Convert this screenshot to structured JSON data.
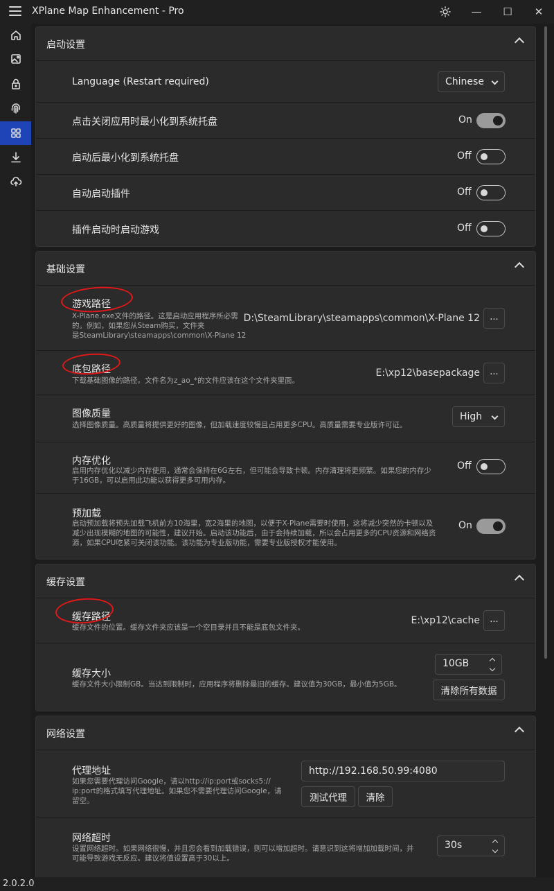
{
  "app": {
    "title": "XPlane Map Enhancement - Pro",
    "version": "2.0.2.0"
  },
  "titlebar": {
    "theme_icon": "sun-icon",
    "minimize_glyph": "—",
    "maximize_glyph": "☐",
    "close_glyph": "✕"
  },
  "sidebar": {
    "items": [
      {
        "icon": "home-icon"
      },
      {
        "icon": "image-icon"
      },
      {
        "icon": "lock-icon"
      },
      {
        "icon": "fingerprint-icon"
      },
      {
        "icon": "grid-icon",
        "active": true
      },
      {
        "icon": "download-icon"
      },
      {
        "icon": "cloud-upload-icon"
      }
    ]
  },
  "colors": {
    "accent": "#1e44b8",
    "annotation": "#e01818"
  },
  "startup": {
    "title": "启动设置",
    "language": {
      "label": "Language (Restart required)",
      "value": "Chinese"
    },
    "minimize_to_tray_on_close": {
      "label": "点击关闭应用时最小化到系统托盘",
      "state": "On"
    },
    "minimize_after_start": {
      "label": "启动后最小化到系统托盘",
      "state": "Off"
    },
    "auto_start_plugin": {
      "label": "自动启动插件",
      "state": "Off"
    },
    "start_game_with_plugin": {
      "label": "插件启动时启动游戏",
      "state": "Off"
    }
  },
  "basic": {
    "title": "基础设置",
    "game_path": {
      "label": "游戏路径",
      "desc": [
        "X-Plane.exe文件的路径。这是启动应用程序所必需",
        "的。例如，如果您从Steam购买，文件夹",
        "是SteamLibrary\\steamapps\\common\\X-Plane 12"
      ],
      "value": "D:\\SteamLibrary\\steamapps\\common\\X-Plane 12",
      "button": "..."
    },
    "base_package_path": {
      "label": "底包路径",
      "desc": "下载基础图像的路径。文件名为z_ao_*的文件应该在这个文件夹里面。",
      "value": "E:\\xp12\\basepackage",
      "button": "..."
    },
    "image_quality": {
      "label": "图像质量",
      "desc": "选择图像质量。高质量将提供更好的图像，但加载速度较慢且占用更多CPU。高质量需要专业版许可证。",
      "value": "High"
    },
    "memory_optimization": {
      "label": "内存优化",
      "desc": [
        "启用内存优化以减少内存使用，通常会保持在6G左右，但可能会导致卡顿。内存清理将更频繁。如果您的内存少",
        "于16GB，可以启用此功能以获得更多可用内存。"
      ],
      "state": "Off"
    },
    "preload": {
      "label": "预加载",
      "desc": [
        "启动预加载将预先加载飞机前方10海里，宽2海里的地图，以便于X-Plane需要时使用，这将减少突然的卡顿以及",
        "减少出现模糊的地图的可能性，建议开始。启动该功能后，由于会持续加载，所以会占用更多的CPU资源和网络资",
        "源，如果CPU吃紧可关闭该功能。该功能为专业版功能，需要专业版授权才能使用。"
      ],
      "state": "On"
    }
  },
  "cache": {
    "title": "缓存设置",
    "cache_path": {
      "label": "缓存路径",
      "desc": "缓存文件的位置。缓存文件夹应该是一个空目录并且不能是底包文件夹。",
      "value": "E:\\xp12\\cache",
      "button": "..."
    },
    "cache_size": {
      "label": "缓存大小",
      "desc": "缓存文件大小限制GB。当达到限制时，应用程序将删除最旧的缓存。建议值为30GB，最小值为5GB。",
      "value": "10GB",
      "clear_button": "清除所有数据"
    }
  },
  "network": {
    "title": "网络设置",
    "proxy": {
      "label": "代理地址",
      "desc": [
        "如果您需要代理访问Google，请以http://ip:port或socks5://",
        "ip:port的格式填写代理地址。如果您不需要代理访问Google，请",
        "留空。"
      ],
      "value": "http://192.168.50.99:4080",
      "test_button": "测试代理",
      "clear_button": "清除"
    },
    "timeout": {
      "label": "网络超时",
      "desc": [
        "设置网络超时。如果网络很慢，并且您会看到加载错误，则可以增加超时。请意识到这将增加加载时间，并",
        "可能导致游戏无反应。建议将值设置高于30以上。"
      ],
      "value": "30s"
    }
  }
}
